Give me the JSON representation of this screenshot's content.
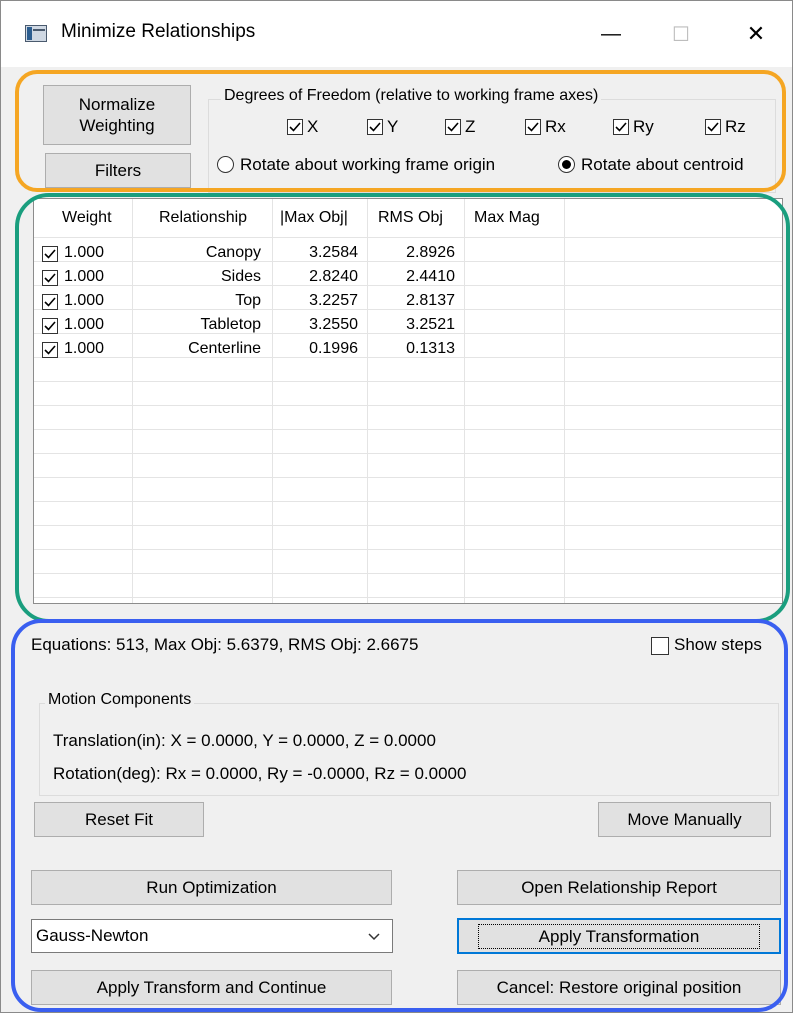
{
  "window": {
    "title": "Minimize Relationships",
    "icons": [
      "app-icon",
      "minimize-icon",
      "maximize-icon",
      "close-icon"
    ],
    "min_glyph": "—",
    "max_glyph": "☐",
    "close_glyph": "✕"
  },
  "top": {
    "normalize_label_1": "Normalize",
    "normalize_label_2": "Weighting",
    "filters_label": "Filters",
    "dof_title": "Degrees of Freedom (relative to working frame axes)",
    "dof": [
      {
        "label": "X",
        "checked": true
      },
      {
        "label": "Y",
        "checked": true
      },
      {
        "label": "Z",
        "checked": true
      },
      {
        "label": "Rx",
        "checked": true
      },
      {
        "label": "Ry",
        "checked": true
      },
      {
        "label": "Rz",
        "checked": true
      }
    ],
    "radio_origin": "Rotate about working frame origin",
    "radio_centroid": "Rotate about centroid",
    "selected_radio": "centroid"
  },
  "table": {
    "headers": [
      "Weight",
      "Relationship",
      "|Max Obj|",
      "RMS Obj",
      "Max Mag"
    ],
    "rows": [
      {
        "checked": true,
        "weight": "1.000",
        "relationship": "Canopy",
        "max_obj": "3.2584",
        "rms_obj": "2.8926",
        "max_mag": ""
      },
      {
        "checked": true,
        "weight": "1.000",
        "relationship": "Sides",
        "max_obj": "2.8240",
        "rms_obj": "2.4410",
        "max_mag": ""
      },
      {
        "checked": true,
        "weight": "1.000",
        "relationship": "Top",
        "max_obj": "3.2257",
        "rms_obj": "2.8137",
        "max_mag": ""
      },
      {
        "checked": true,
        "weight": "1.000",
        "relationship": "Tabletop",
        "max_obj": "3.2550",
        "rms_obj": "3.2521",
        "max_mag": ""
      },
      {
        "checked": true,
        "weight": "1.000",
        "relationship": "Centerline",
        "max_obj": "0.1996",
        "rms_obj": "0.1313",
        "max_mag": ""
      }
    ]
  },
  "status": {
    "equations_text": "Equations: 513, Max Obj: 5.6379, RMS Obj: 2.6675",
    "show_steps_label": "Show steps",
    "show_steps_checked": false
  },
  "motion": {
    "title": "Motion Components",
    "translation_text": "Translation(in):  X =  0.0000, Y =  0.0000, Z =  0.0000",
    "rotation_text": "Rotation(deg):  Rx =  0.0000, Ry =  -0.0000, Rz =  0.0000"
  },
  "buttons": {
    "reset_fit": "Reset Fit",
    "move_manually": "Move Manually",
    "run_optimization": "Run Optimization",
    "open_report": "Open Relationship Report",
    "apply_transformation": "Apply Transformation",
    "apply_continue": "Apply Transform and Continue",
    "cancel_restore": "Cancel: Restore original position"
  },
  "solver": {
    "selected": "Gauss-Newton"
  },
  "highlight_colors": {
    "top_section": "#f5a623",
    "table_section": "#1a9e7e",
    "bottom_section": "#3a5ff0"
  }
}
